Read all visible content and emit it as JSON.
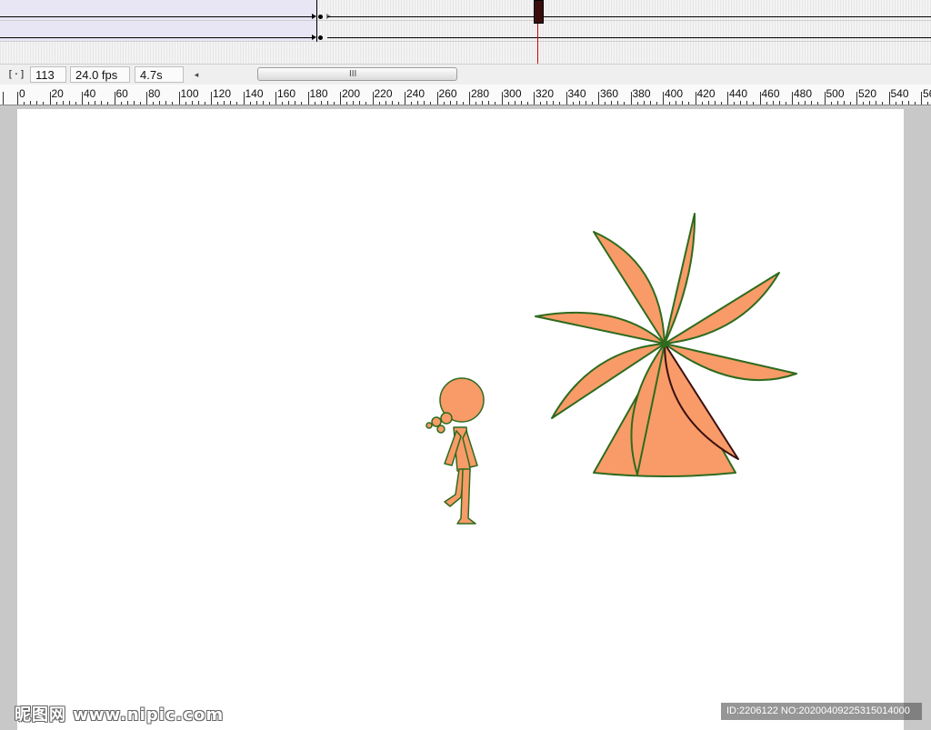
{
  "statusbar": {
    "center_frame_icon": "[·]",
    "frame": "113",
    "fps": "24.0 fps",
    "time": "4.7s",
    "scroll_left_arrow": "◂",
    "scroll_grip": "III"
  },
  "ruler": {
    "labels": [
      "0",
      "20",
      "40",
      "60",
      "80",
      "100",
      "120",
      "140",
      "160",
      "180",
      "200",
      "220",
      "240",
      "260",
      "280",
      "300",
      "320",
      "340",
      "360",
      "380",
      "400",
      "420",
      "440",
      "460",
      "480",
      "500",
      "520",
      "540",
      "56"
    ]
  },
  "icons": {
    "center_frame": "center-frame-icon",
    "keyframe": "keyframe-icon",
    "tween_arrow": "arrow-icon"
  },
  "colors": {
    "shape_fill": "#F89B68",
    "shape_stroke": "#2E6B1E",
    "playhead": "#CC0000",
    "tween_bg": "#E8E6F4"
  },
  "watermark": {
    "left": "昵图网 www.nipic.com",
    "right": "ID:2206122 NO:20200409225315014000"
  }
}
